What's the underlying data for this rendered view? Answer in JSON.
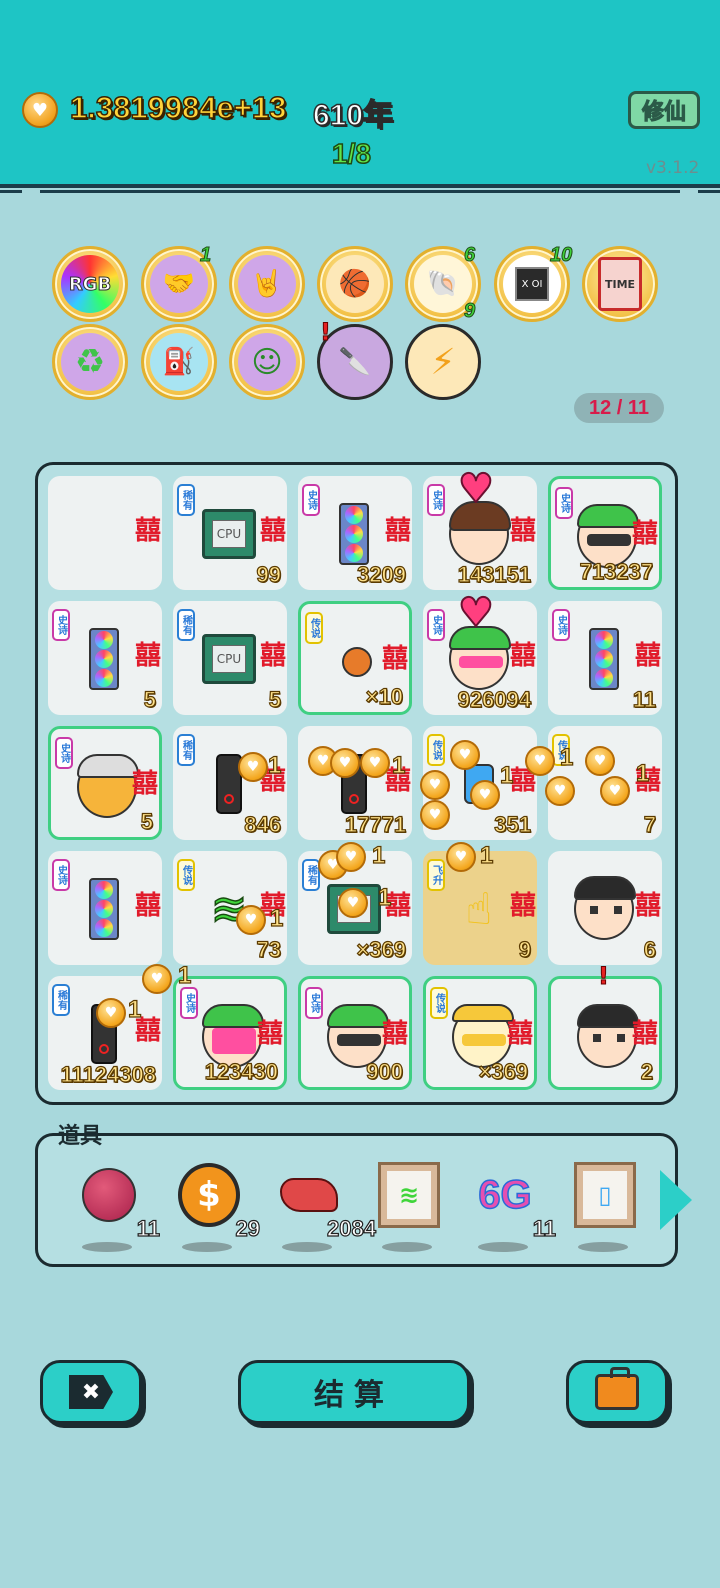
{
  "header": {
    "coins": "1.3819984e+13",
    "years": "610年",
    "stage": "1/8",
    "xiuxian_label": "修仙",
    "version": "v3.1.2"
  },
  "badges": [
    {
      "icon": "rgb-icon",
      "label": "RGB",
      "count": ""
    },
    {
      "icon": "handshake-icon",
      "label": "🤝",
      "count": "1"
    },
    {
      "icon": "rock-hand-icon",
      "label": "🤘",
      "count": ""
    },
    {
      "icon": "basketballs-icon",
      "label": "🏀",
      "count": ""
    },
    {
      "icon": "shell-icon",
      "label": "🐚",
      "count": "6",
      "count2": "9"
    },
    {
      "icon": "cpu-chip-icon",
      "label": "X OI",
      "count": "10"
    },
    {
      "icon": "time-magazine-icon",
      "label": "TIME",
      "count": ""
    },
    {
      "icon": "recycle-icon",
      "label": "♻",
      "count": ""
    },
    {
      "icon": "pump-icon",
      "label": "⛽",
      "count": ""
    },
    {
      "icon": "formula-face-icon",
      "label": "☺",
      "count": ""
    },
    {
      "icon": "cleaver-icon",
      "label": "🔪",
      "count": ""
    },
    {
      "icon": "lightning-icon",
      "label": "⚡",
      "count": ""
    }
  ],
  "progress": "12 / 11",
  "cells": [
    {
      "tag": "",
      "tagType": "",
      "num": "",
      "item": "blank"
    },
    {
      "tag": "稀有",
      "tagType": "blue",
      "num": "99",
      "item": "cpu"
    },
    {
      "tag": "史诗",
      "tagType": "pink",
      "num": "3209",
      "item": "gpu"
    },
    {
      "tag": "史诗",
      "tagType": "pink",
      "num": "143151",
      "item": "girl"
    },
    {
      "tag": "史诗",
      "tagType": "pink",
      "num": "713237",
      "item": "face-green",
      "hl": true
    },
    {
      "tag": "史诗",
      "tagType": "pink",
      "num": "5",
      "item": "gpu"
    },
    {
      "tag": "稀有",
      "tagType": "blue",
      "num": "5",
      "item": "cpu"
    },
    {
      "tag": "传说",
      "tagType": "yellow",
      "num": "×10",
      "item": "basket",
      "hl": true
    },
    {
      "tag": "史诗",
      "tagType": "pink",
      "num": "926094",
      "item": "face-pink"
    },
    {
      "tag": "史诗",
      "tagType": "pink",
      "num": "11",
      "item": "gpu"
    },
    {
      "tag": "史诗",
      "tagType": "pink",
      "num": "5",
      "item": "chick",
      "hl": true
    },
    {
      "tag": "稀有",
      "tagType": "blue",
      "num": "846",
      "item": "phone"
    },
    {
      "tag": "",
      "tagType": "",
      "num": "17771",
      "item": "phone"
    },
    {
      "tag": "传说",
      "tagType": "yellow",
      "num": "351",
      "item": "watch"
    },
    {
      "tag": "传说",
      "tagType": "yellow",
      "num": "7",
      "item": "blank"
    },
    {
      "tag": "史诗",
      "tagType": "pink",
      "num": "",
      "item": "gpu"
    },
    {
      "tag": "传说",
      "tagType": "yellow",
      "num": "73",
      "item": "wifi"
    },
    {
      "tag": "稀有",
      "tagType": "blue",
      "num": "×369",
      "item": "cpu"
    },
    {
      "tag": "飞升",
      "tagType": "yellow",
      "num": "9",
      "item": "hand",
      "gold": true
    },
    {
      "tag": "",
      "tagType": "",
      "num": "6",
      "item": "face-dark"
    },
    {
      "tag": "稀有",
      "tagType": "blue",
      "num": "11124308",
      "item": "phone"
    },
    {
      "tag": "史诗",
      "tagType": "pink",
      "num": "123430",
      "item": "face-heart",
      "hl": true
    },
    {
      "tag": "史诗",
      "tagType": "pink",
      "num": "900",
      "item": "face-green",
      "hl": true
    },
    {
      "tag": "传说",
      "tagType": "yellow",
      "num": "×369",
      "item": "king",
      "hl": true
    },
    {
      "tag": "",
      "tagType": "",
      "num": "2",
      "item": "face-dark",
      "hl": true
    }
  ],
  "xi_char": "囍",
  "floating_plus": "1",
  "props_label": "道具",
  "props": [
    {
      "name": "lychee",
      "label": "●",
      "count": "11"
    },
    {
      "name": "dollar-coin",
      "label": "$",
      "count": "29"
    },
    {
      "name": "liver",
      "label": "▰",
      "count": "2084"
    },
    {
      "name": "wifi-frame",
      "label": "≋",
      "count": ""
    },
    {
      "name": "6g",
      "label": "6G",
      "count": "11"
    },
    {
      "name": "phone-frame",
      "label": "▯",
      "count": ""
    }
  ],
  "buttons": {
    "close_label": "✖",
    "settle_label": "结算"
  }
}
